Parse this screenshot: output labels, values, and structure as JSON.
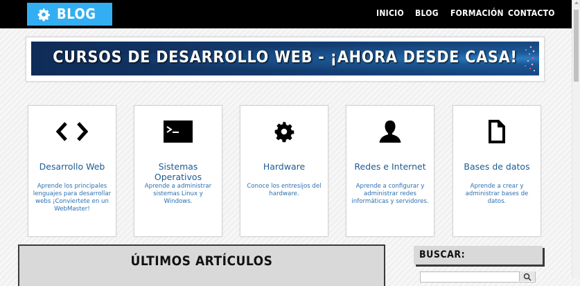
{
  "header": {
    "logo_text": "BLOG",
    "nav": [
      "INICIO",
      "BLOG",
      "FORMACIÓN",
      "CONTACTO"
    ]
  },
  "banner": {
    "text": "CURSOS DE DESARROLLO WEB - ¡AHORA DESDE CASA!"
  },
  "cards": [
    {
      "icon": "code-icon",
      "title": "Desarrollo Web",
      "desc": "Aprende los principales lenguajes para desarrollar webs ¡Conviertete en un WebMaster!"
    },
    {
      "icon": "terminal-icon",
      "title": "Sistemas Operativos",
      "desc": "Aprende a administrar sistemas Linux y Windows."
    },
    {
      "icon": "gear-icon",
      "title": "Hardware",
      "desc": "Conoce los entresijos del hardware."
    },
    {
      "icon": "user-icon",
      "title": "Redes e Internet",
      "desc": "Aprende a configurar y administrar redes informáticas y servidores."
    },
    {
      "icon": "document-icon",
      "title": "Bases de datos",
      "desc": "Aprende a crear y administrar bases de datos."
    }
  ],
  "latest": {
    "title": "ÚLTIMOS ARTÍCULOS"
  },
  "sidebar": {
    "search_title": "BUSCAR:",
    "search_value": ""
  },
  "colors": {
    "accent": "#34aef2",
    "header_bg": "#000000",
    "link": "#1d5a91"
  }
}
